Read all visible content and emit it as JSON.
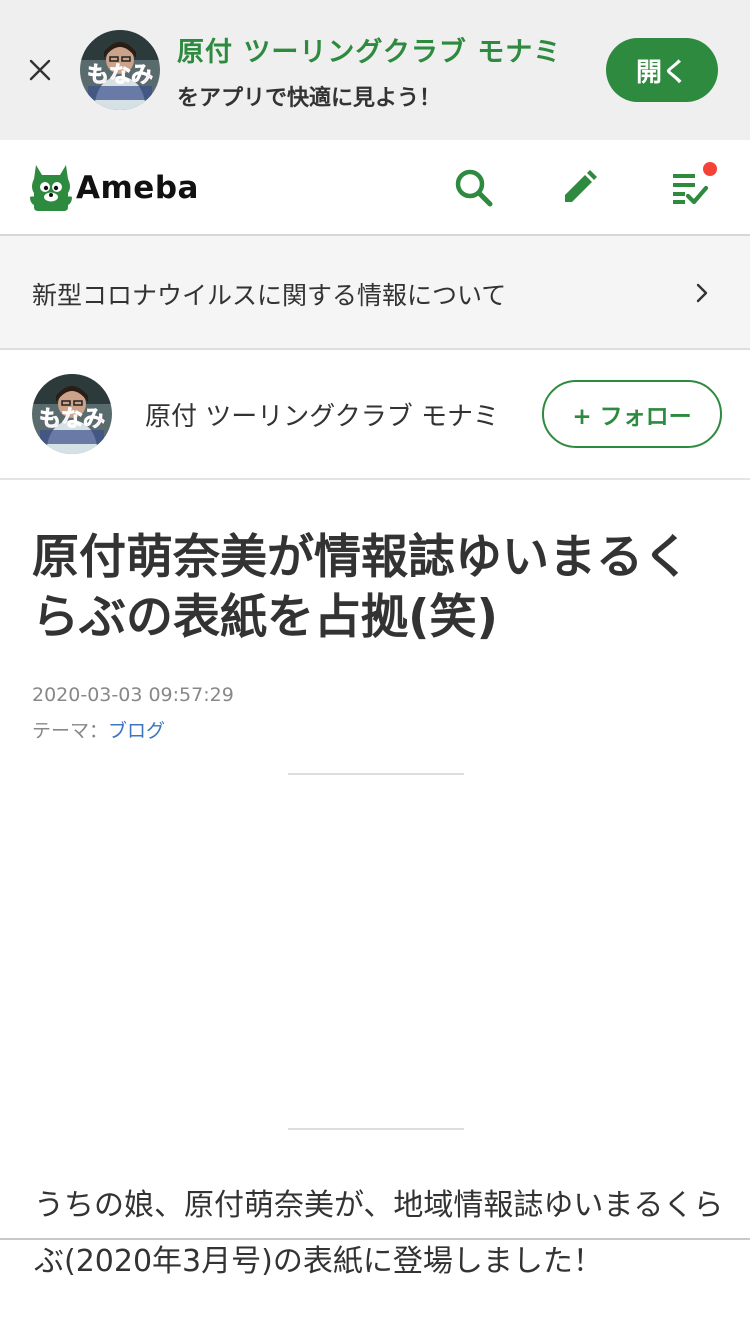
{
  "app_banner": {
    "title": "原付 ツーリングクラブ モナミ",
    "subtitle": "をアプリで快適に見よう！",
    "open_label": "開く",
    "avatar_text": "もなみ"
  },
  "header": {
    "logo_text": "Ameba",
    "brand_color": "#2d8a3e",
    "notification_color": "#f44336",
    "icons": [
      "search-icon",
      "edit-icon",
      "checklist-icon"
    ]
  },
  "notice": {
    "text": "新型コロナウイルスに関する情報について"
  },
  "blog": {
    "name": "原付 ツーリングクラブ モナミ",
    "avatar_text": "もなみ",
    "follow_label": "+ フォロー"
  },
  "article": {
    "title": "原付萌奈美が情報誌ゆいまるくらぶの表紙を占拠(笑)",
    "date": "2020-03-03 09:57:29",
    "theme_label": "テーマ：",
    "theme_value": "ブログ",
    "body": "うちの娘、原付萌奈美が、地域情報誌ゆいまるくらぶ(2020年3月号)の表紙に登場しました！"
  }
}
